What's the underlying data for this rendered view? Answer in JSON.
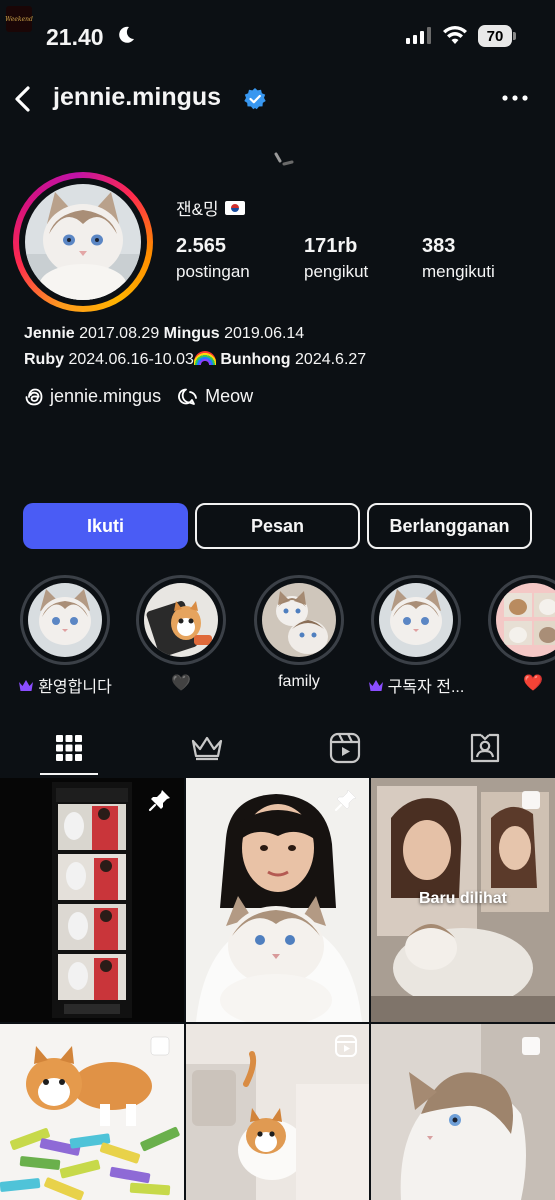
{
  "status_bar": {
    "app_badge": "Weekend",
    "time": "21.40",
    "battery": "70"
  },
  "header": {
    "username": "jennie.mingus"
  },
  "profile": {
    "display_name": "잰&밍",
    "stats": [
      {
        "value": "2.565",
        "label": "postingan"
      },
      {
        "value": "171rb",
        "label": "pengikut"
      },
      {
        "value": "383",
        "label": "mengikuti"
      }
    ],
    "bio": {
      "line1": [
        {
          "name": "Jennie",
          "date": "2017.08.29"
        },
        {
          "name": "Mingus",
          "date": "2019.06.14"
        }
      ],
      "line2": [
        {
          "name": "Ruby",
          "date": "2024.06.16-10.03"
        },
        {
          "name": "Bunhong",
          "date": "2024.6.27"
        }
      ]
    },
    "links": {
      "threads": "jennie.mingus",
      "channel": "Meow"
    }
  },
  "buttons": {
    "follow": "Ikuti",
    "message": "Pesan",
    "subscribe": "Berlangganan"
  },
  "highlights": [
    {
      "label": "환영합니다",
      "icon": "crown-icon"
    },
    {
      "label": "🖤",
      "icon": ""
    },
    {
      "label": "family",
      "icon": ""
    },
    {
      "label": "구독자 전...",
      "icon": "crown-icon"
    },
    {
      "label": "❤️",
      "icon": ""
    }
  ],
  "tabs": [
    "grid-icon",
    "subscriber-crown-icon",
    "reels-icon",
    "tagged-icon"
  ],
  "grid": {
    "recent_label": "Baru dilihat"
  },
  "colors": {
    "background": "#0c1014",
    "follow_button": "#4a5cf5",
    "verified": "#3897f0"
  }
}
